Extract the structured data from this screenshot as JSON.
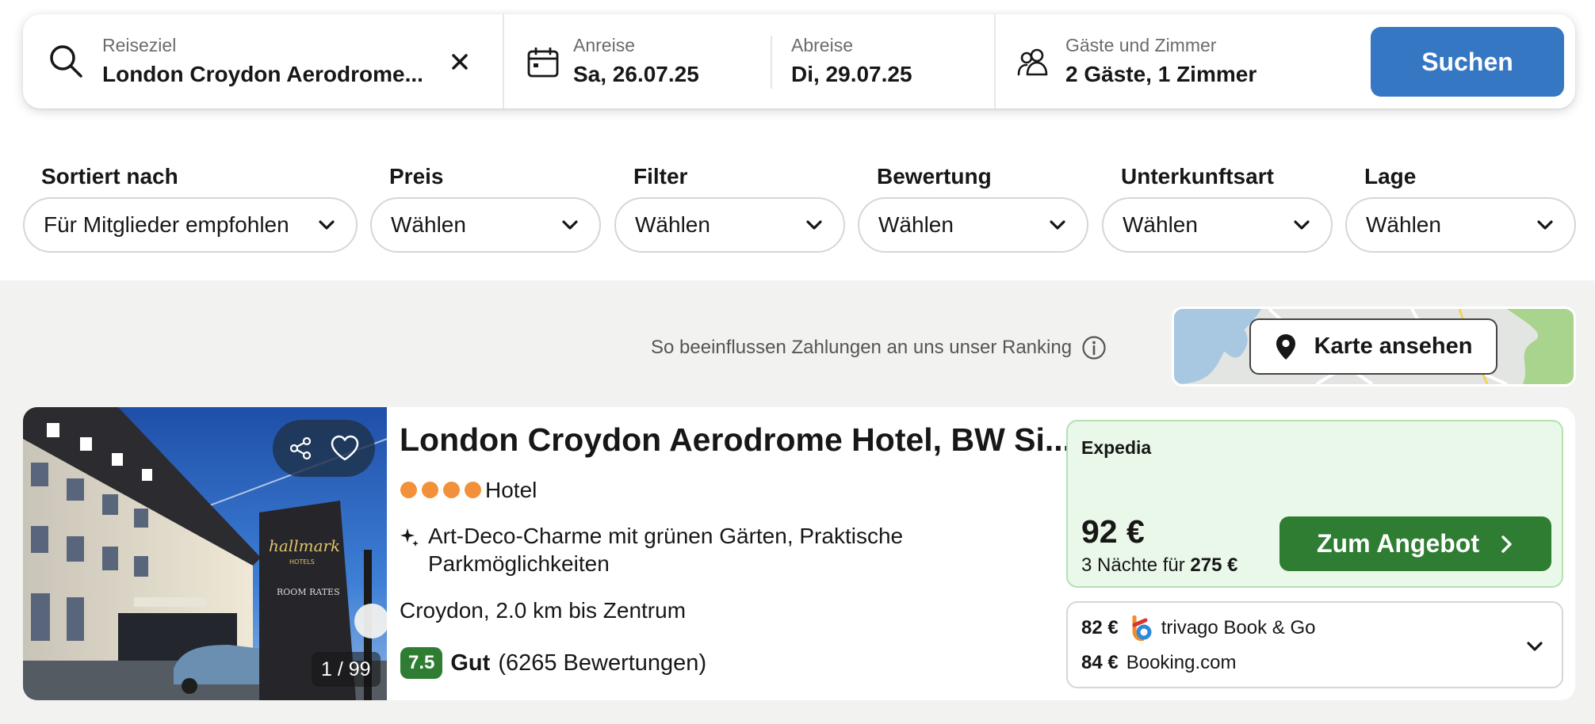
{
  "search": {
    "destination_label": "Reiseziel",
    "destination_value": "London Croydon Aerodrome...",
    "checkin_label": "Anreise",
    "checkin_value": "Sa, 26.07.25",
    "checkout_label": "Abreise",
    "checkout_value": "Di, 29.07.25",
    "guests_label": "Gäste und Zimmer",
    "guests_value": "2 Gäste, 1 Zimmer",
    "search_button": "Suchen"
  },
  "filters": [
    {
      "label": "Sortiert nach",
      "value": "Für Mitglieder empfohlen"
    },
    {
      "label": "Preis",
      "value": "Wählen"
    },
    {
      "label": "Filter",
      "value": "Wählen"
    },
    {
      "label": "Bewertung",
      "value": "Wählen"
    },
    {
      "label": "Unterkunftsart",
      "value": "Wählen"
    },
    {
      "label": "Lage",
      "value": "Wählen"
    }
  ],
  "ranking_note": "So beeinflussen Zahlungen an uns unser Ranking",
  "map_button": "Karte ansehen",
  "hotel": {
    "name": "London Croydon Aerodrome Hotel, BW Si...",
    "stars": 4,
    "type": "Hotel",
    "highlight": "Art-Deco-Charme mit grünen Gärten, Praktische Parkmöglichkeiten",
    "location": "Croydon, 2.0 km bis Zentrum",
    "rating_score": "7.5",
    "rating_text": "Gut",
    "rating_count": "(6265 Bewertungen)",
    "photo_counter": "1 / 99",
    "photo_sign_text": "hallmark",
    "photo_sign_sub": "HOTELS",
    "photo_sign_rates": "ROOM RATES"
  },
  "offer": {
    "provider": "Expedia",
    "price": "92 €",
    "nights_text": "3 Nächte für",
    "total": "275 €",
    "deal_button": "Zum Angebot"
  },
  "alt_offers": [
    {
      "price": "82 €",
      "provider": "trivago Book & Go"
    },
    {
      "price": "84 €",
      "provider": "Booking.com"
    }
  ],
  "colors": {
    "search_button": "#3677c4",
    "deal_button": "#2f7d32",
    "rating_badge": "#2f7d32",
    "star": "#f2913a",
    "offer_bg": "#eaf8e9"
  }
}
